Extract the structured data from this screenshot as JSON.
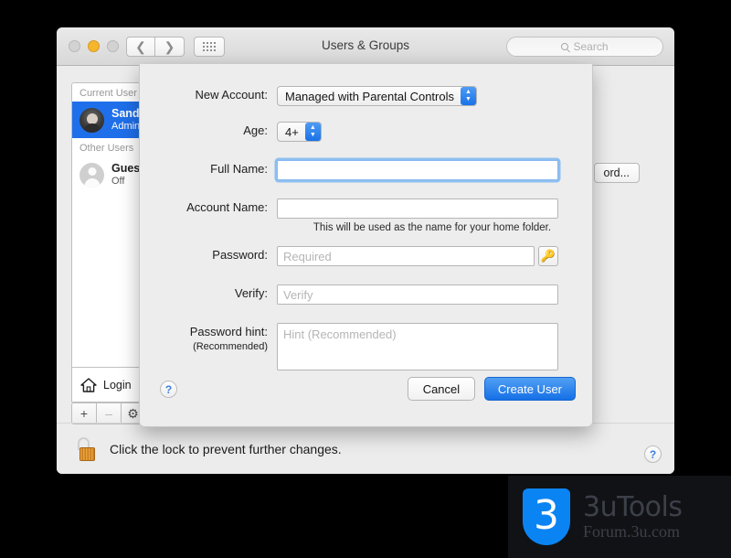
{
  "window": {
    "title": "Users & Groups",
    "traffic_lights": [
      "close",
      "minimize",
      "zoom"
    ],
    "nav_back_icon": "chevron-left-icon",
    "nav_forward_icon": "chevron-right-icon",
    "grid_icon": "show-all-icon",
    "search": {
      "placeholder": "Search",
      "icon": "search-icon"
    },
    "help_icon": "?"
  },
  "sidebar": {
    "groups": [
      {
        "header": "Current User",
        "users": [
          {
            "name": "Sandr",
            "sub": "Admin",
            "avatar": "user-photo",
            "selected": true
          }
        ]
      },
      {
        "header": "Other Users",
        "users": [
          {
            "name": "Gues",
            "sub": "Off",
            "avatar": "generic-user",
            "selected": false
          }
        ]
      }
    ],
    "login_items_label": "Login",
    "login_items_icon": "home-icon",
    "toolbar": {
      "add_label": "+",
      "remove_label": "–",
      "settings_icon": "gear-icon"
    }
  },
  "right_pane": {
    "password_button_label": "ord..."
  },
  "lock_bar": {
    "text": "Click the lock to prevent further changes.",
    "icon": "unlocked-padlock-icon"
  },
  "sheet": {
    "new_account": {
      "label": "New Account:",
      "value": "Managed with Parental Controls",
      "chevron_icon": "up-down-chevron-icon"
    },
    "age": {
      "label": "Age:",
      "value": "4+",
      "chevron_icon": "up-down-chevron-icon"
    },
    "full_name": {
      "label": "Full Name:",
      "value": "",
      "placeholder": ""
    },
    "account_name": {
      "label": "Account Name:",
      "value": "",
      "placeholder": "",
      "helper": "This will be used as the name for your home folder."
    },
    "password": {
      "label": "Password:",
      "value": "",
      "placeholder": "Required",
      "key_button_icon": "key-icon"
    },
    "verify": {
      "label": "Verify:",
      "value": "",
      "placeholder": "Verify"
    },
    "password_hint": {
      "label": "Password hint:",
      "sub_label": "(Recommended)",
      "value": "",
      "placeholder": "Hint (Recommended)"
    },
    "footer": {
      "help_icon": "?",
      "cancel_label": "Cancel",
      "create_label": "Create User"
    }
  },
  "watermark": {
    "logo_glyph": "3",
    "title": "3uTools",
    "subtitle": "Forum.3u.com"
  },
  "colors": {
    "accent_blue": "#1570e6",
    "selection_blue": "#1f6fea",
    "window_chrome": "#ececec",
    "sheet_bg": "#ededed",
    "padlock_gold": "#e9a23b"
  }
}
